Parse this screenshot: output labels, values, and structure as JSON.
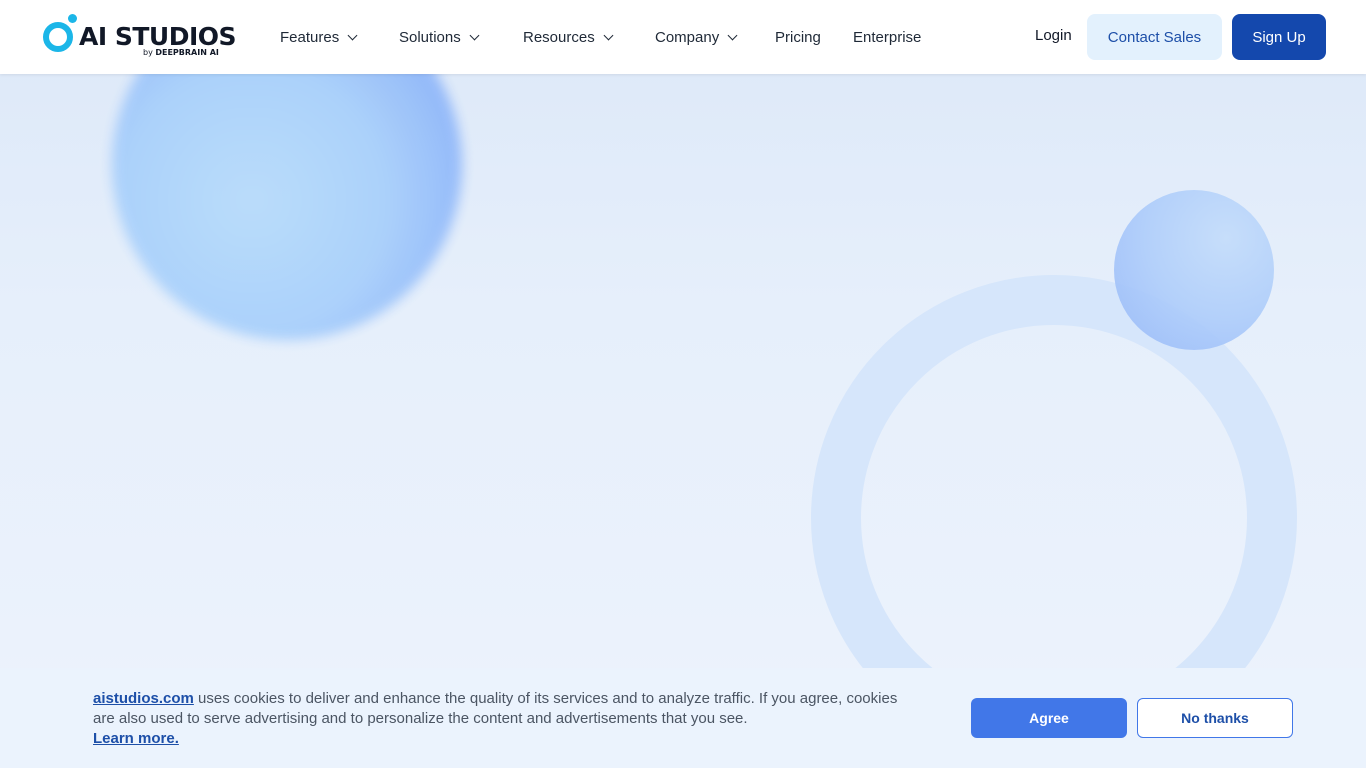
{
  "header": {
    "logo": {
      "text": "AI STUDIOS",
      "sub_prefix": "by ",
      "sub_brand": "DEEPBRAIN AI"
    },
    "nav": [
      {
        "label": "Features",
        "dropdown": true
      },
      {
        "label": "Solutions",
        "dropdown": true
      },
      {
        "label": "Resources",
        "dropdown": true
      },
      {
        "label": "Company",
        "dropdown": true
      },
      {
        "label": "Pricing",
        "dropdown": false
      },
      {
        "label": "Enterprise",
        "dropdown": false
      }
    ],
    "login_label": "Login",
    "contact_label": "Contact Sales",
    "signup_label": "Sign Up"
  },
  "cookie_banner": {
    "site_link": "aistudios.com",
    "message": " uses cookies to deliver and enhance the quality of its services and to analyze traffic. If you agree, cookies are also used to serve advertising and to personalize the content and advertisements that you see.",
    "learn_more": "Learn more.",
    "agree_label": "Agree",
    "decline_label": "No thanks"
  },
  "colors": {
    "brand_blue": "#1448ad",
    "logo_cyan": "#1bb6e8",
    "accent": "#4177e8"
  }
}
